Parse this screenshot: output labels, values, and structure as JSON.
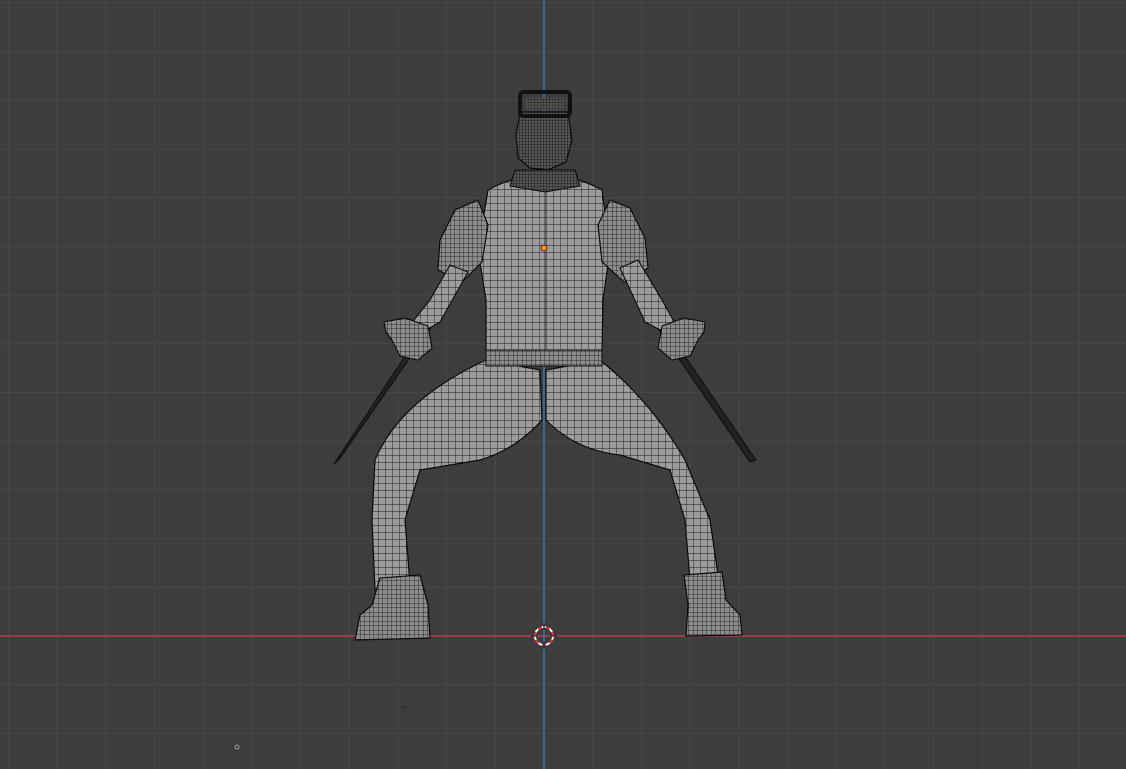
{
  "viewport": {
    "view": "back-orthographic",
    "shading": "wireframe",
    "grid": true,
    "colors": {
      "background": "#3d3d3d",
      "grid_line": "#484848",
      "x_axis": "#b8404f",
      "z_axis": "#3f79b5",
      "wire": "#101010",
      "mesh_fill": "#9a9a9a",
      "origin": "#ff8a1c",
      "cursor_red": "#e23a3a",
      "cursor_white": "#ffffff"
    }
  },
  "scene": {
    "object": "character-mesh",
    "selected_origin_marker": true,
    "cursor_3d": true
  }
}
